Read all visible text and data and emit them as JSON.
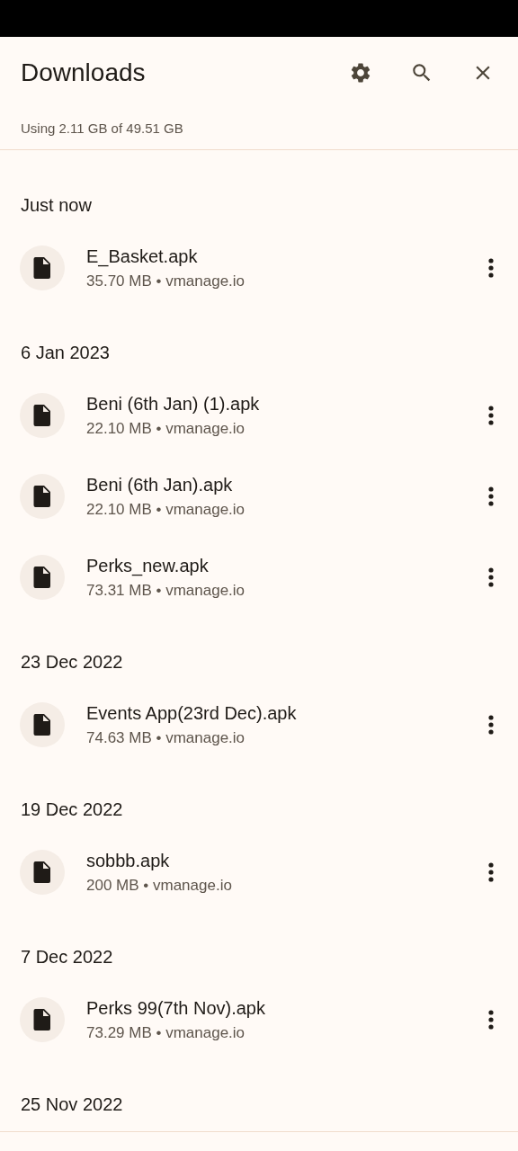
{
  "header": {
    "title": "Downloads",
    "storage": "Using 2.11 GB of 49.51 GB"
  },
  "groups": [
    {
      "date": "Just now",
      "items": [
        {
          "name": "E_Basket.apk",
          "details": "35.70 MB • vmanage.io"
        }
      ]
    },
    {
      "date": "6 Jan 2023",
      "items": [
        {
          "name": "Beni (6th Jan) (1).apk",
          "details": "22.10 MB • vmanage.io"
        },
        {
          "name": "Beni (6th Jan).apk",
          "details": "22.10 MB • vmanage.io"
        },
        {
          "name": "Perks_new.apk",
          "details": "73.31 MB • vmanage.io"
        }
      ]
    },
    {
      "date": "23 Dec 2022",
      "items": [
        {
          "name": "Events App(23rd Dec).apk",
          "details": "74.63 MB • vmanage.io"
        }
      ]
    },
    {
      "date": "19 Dec 2022",
      "items": [
        {
          "name": "sobbb.apk",
          "details": "200 MB • vmanage.io"
        }
      ]
    },
    {
      "date": "7 Dec 2022",
      "items": [
        {
          "name": "Perks 99(7th Nov).apk",
          "details": "73.29 MB • vmanage.io"
        }
      ]
    },
    {
      "date": "25 Nov 2022"
    }
  ]
}
